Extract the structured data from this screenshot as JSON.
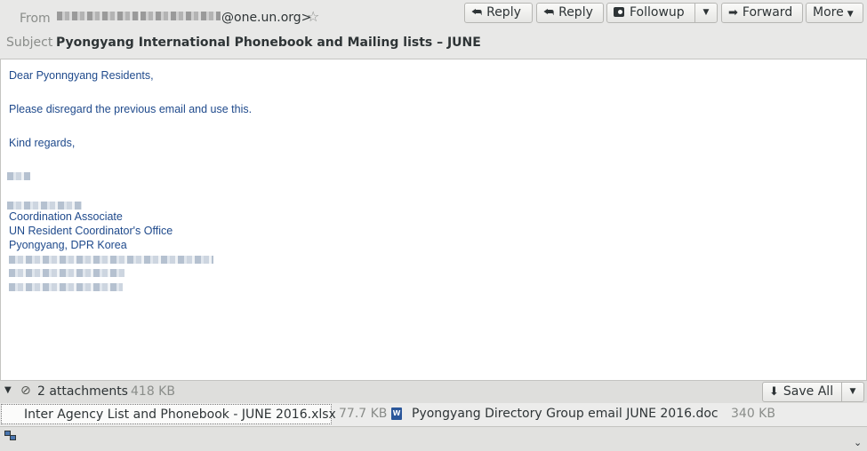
{
  "header": {
    "from_label": "From",
    "from_address_visible": "@one.un.org>",
    "subject_label": "Subject",
    "subject": "Pyongyang International Phonebook and Mailing lists – JUNE",
    "buttons": {
      "reply": "Reply",
      "reply_all": "Reply",
      "followup": "Followup",
      "forward": "Forward",
      "more": "More"
    }
  },
  "body": {
    "greeting": "Dear Pyonngyang Residents,",
    "line1": "Please disregard the previous email and use this.",
    "closing": "Kind regards,",
    "signature": {
      "title": "Coordination Associate",
      "office": "UN Resident Coordinator's Office",
      "location": "Pyongyang, DPR Korea"
    }
  },
  "attachments": {
    "count_label": "2 attachments",
    "total_size": "418 KB",
    "save_all_label": "Save All",
    "items": [
      {
        "name": "Inter Agency List and Phonebook - JUNE 2016.xlsx",
        "size": "77.7 KB",
        "icon": "spreadsheet-icon"
      },
      {
        "name": "Pyongyang Directory Group email JUNE 2016.doc",
        "size": "340 KB",
        "icon": "word-document-icon"
      }
    ]
  },
  "colors": {
    "body_text": "#1f4a8c",
    "xlsx_icon": "#2f8a36",
    "doc_icon": "#2b579a"
  }
}
